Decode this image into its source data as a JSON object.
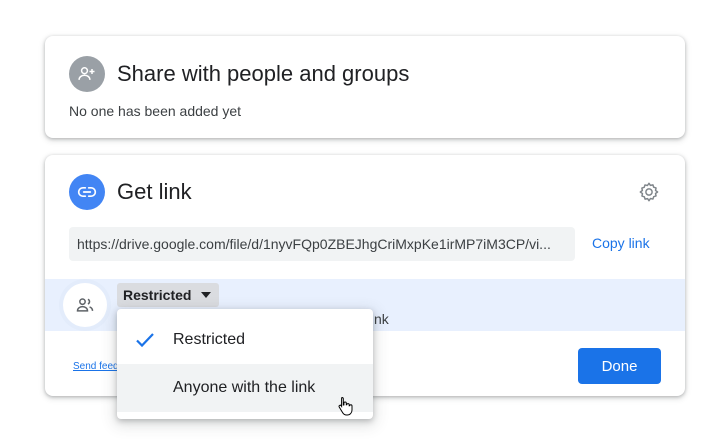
{
  "share": {
    "title": "Share with people and groups",
    "empty_text": "No one has been added yet",
    "icon": "person-add-icon"
  },
  "link": {
    "title": "Get link",
    "icon": "link-icon",
    "url": "https://drive.google.com/file/d/1nyvFQp0ZBEJhgCriMxpKe1irMP7iM3CP/vi...",
    "copy_label": "Copy link",
    "settings_icon": "gear-icon",
    "access": {
      "selected": "Restricted",
      "description_visible": "nk",
      "avatar_icon": "people-icon"
    },
    "send_feedback": "Send feedback",
    "done_label": "Done"
  },
  "dropdown": {
    "options": [
      {
        "label": "Restricted",
        "selected": true
      },
      {
        "label": "Anyone with the link",
        "selected": false
      }
    ]
  },
  "colors": {
    "accent": "#1a73e8",
    "share_icon_bg": "#9aa0a6",
    "link_icon_bg": "#4285f4",
    "access_band": "#e8f0fe"
  }
}
